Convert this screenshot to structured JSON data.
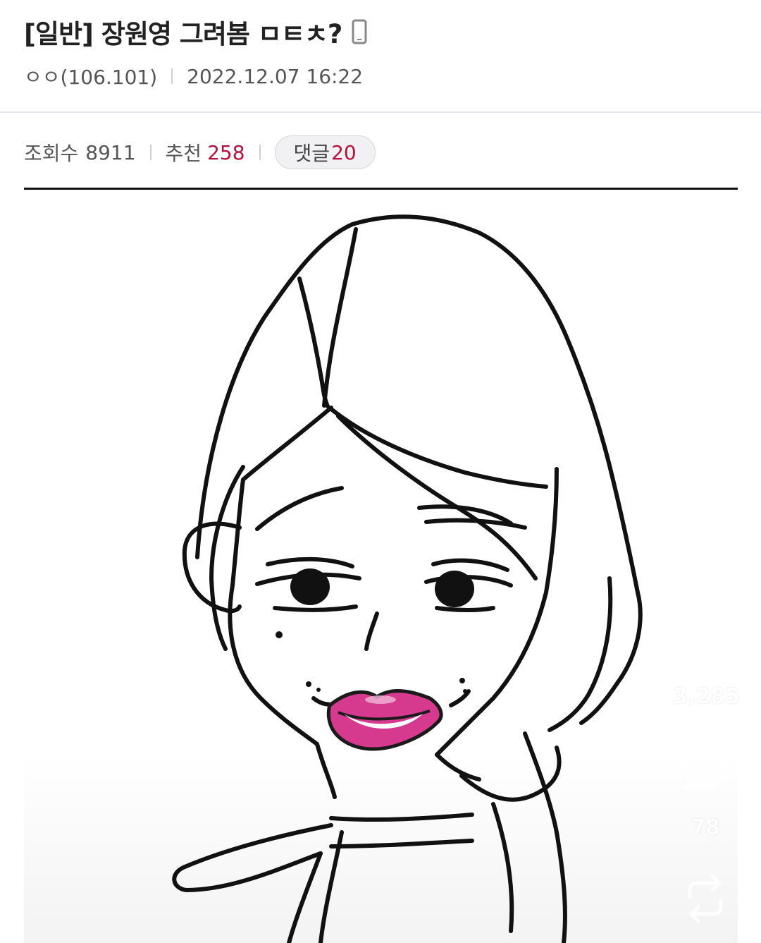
{
  "post": {
    "title": "[일반] 장원영 그려봄 ㅁㅌㅊ?",
    "author": "ㅇㅇ(106.101)",
    "datetime": "2022.12.07 16:22",
    "views_label": "조회수",
    "views_value": "8911",
    "recommend_label": "추천",
    "recommend_value": "258",
    "comments_label": "댓글",
    "comments_value": "20"
  },
  "side_actions": {
    "like_count": "3,285",
    "comment_count": "78"
  },
  "colors": {
    "accent_red": "#b5103c",
    "lip_pink": "#d63a8e"
  },
  "icons": {
    "device": "phone-icon",
    "like": "heart-icon",
    "comment": "comment-bubble-icon",
    "share": "repost-icon"
  }
}
